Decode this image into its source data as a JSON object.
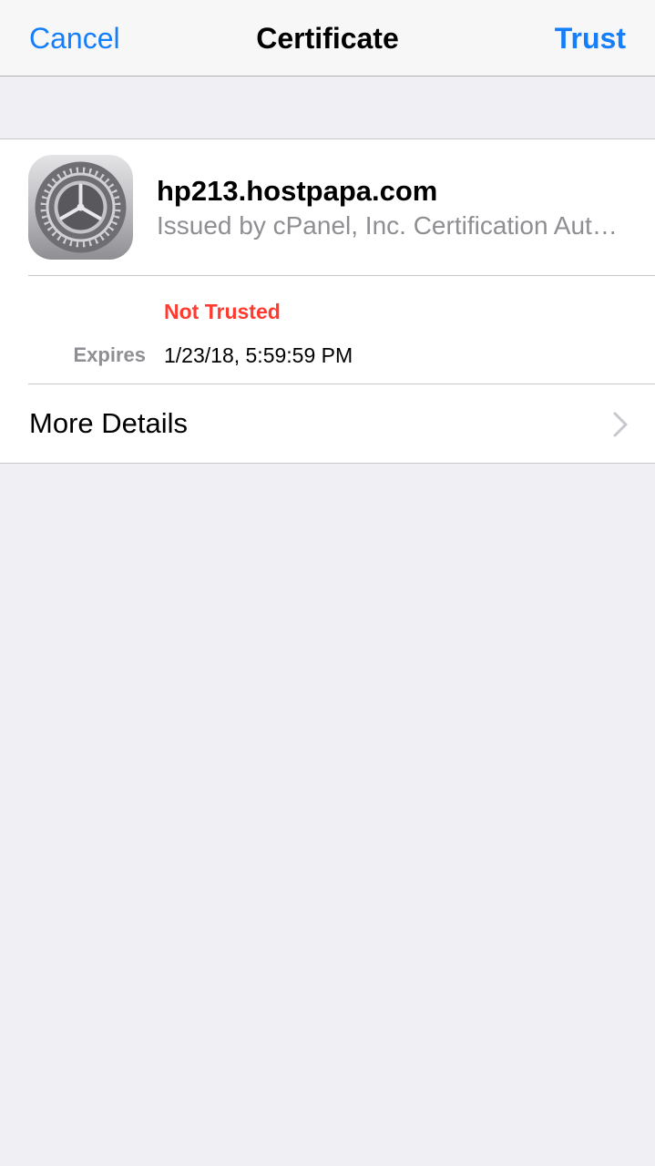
{
  "navbar": {
    "cancel_label": "Cancel",
    "title": "Certificate",
    "trust_label": "Trust"
  },
  "certificate": {
    "name": "hp213.hostpapa.com",
    "issuer": "Issued by cPanel, Inc. Certification Authority",
    "icon": "settings-gear-icon",
    "trust_status": "Not Trusted",
    "expires_label": "Expires",
    "expires_value": "1/23/18, 5:59:59 PM"
  },
  "more_details": {
    "label": "More Details",
    "icon": "chevron-right-icon"
  },
  "colors": {
    "accent": "#157efb",
    "danger": "#ff3b30",
    "secondary_text": "#8e8e93",
    "background": "#efeff4"
  }
}
